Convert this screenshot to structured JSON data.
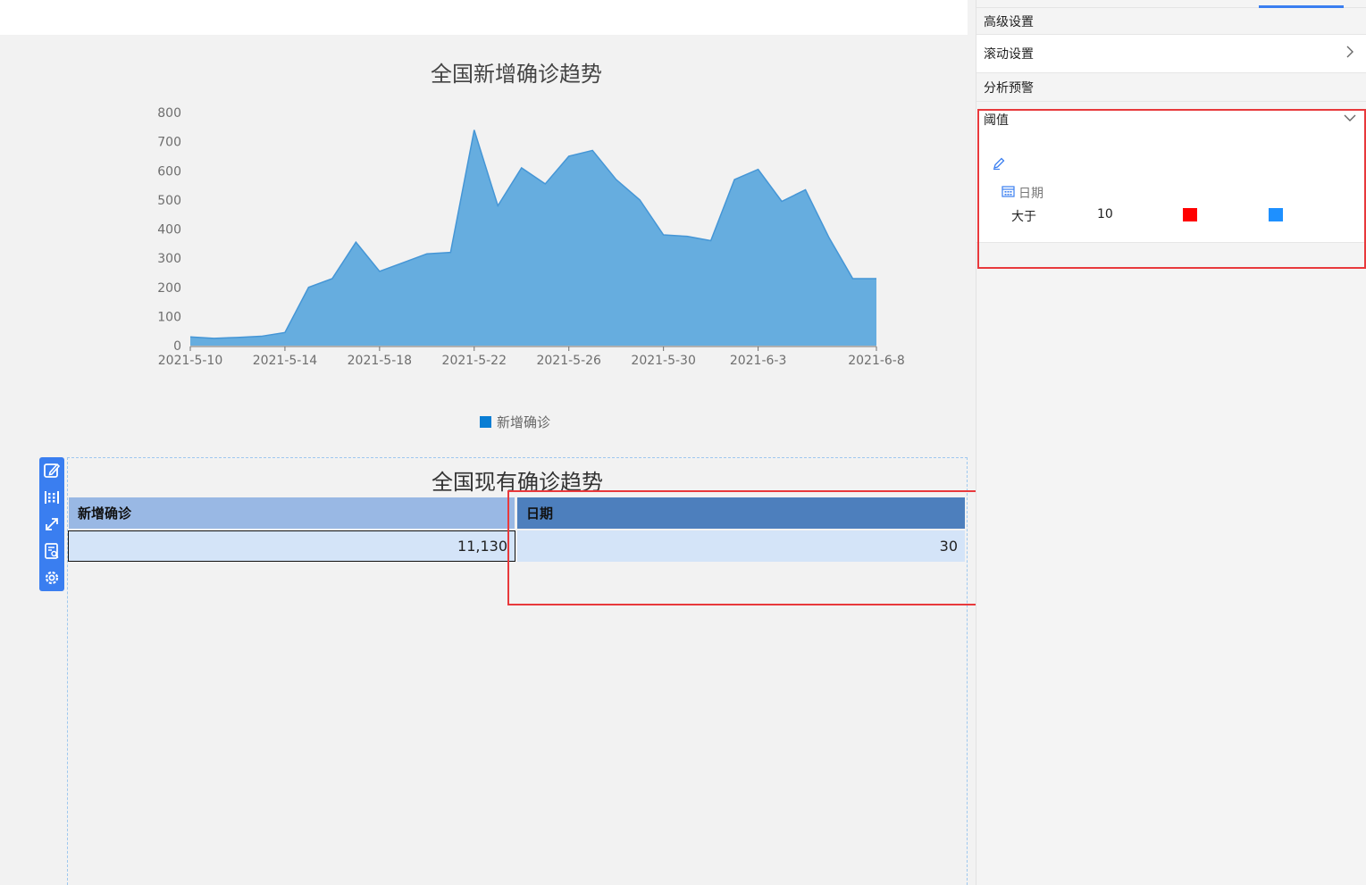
{
  "chart": {
    "title": "全国新增确诊趋势",
    "legend_label": "新增确诊",
    "color": "#66addf",
    "stroke": "#4596d6"
  },
  "chart_data": {
    "type": "area",
    "title": "全国新增确诊趋势",
    "x": [
      "2021-5-10",
      "2021-5-11",
      "2021-5-12",
      "2021-5-13",
      "2021-5-14",
      "2021-5-15",
      "2021-5-16",
      "2021-5-17",
      "2021-5-18",
      "2021-5-19",
      "2021-5-20",
      "2021-5-21",
      "2021-5-22",
      "2021-5-23",
      "2021-5-24",
      "2021-5-25",
      "2021-5-26",
      "2021-5-27",
      "2021-5-28",
      "2021-5-29",
      "2021-5-30",
      "2021-5-31",
      "2021-6-1",
      "2021-6-2",
      "2021-6-3",
      "2021-6-4",
      "2021-6-5",
      "2021-6-6",
      "2021-6-7",
      "2021-6-8"
    ],
    "x_ticks": [
      "2021-5-10",
      "2021-5-14",
      "2021-5-18",
      "2021-5-22",
      "2021-5-26",
      "2021-5-30",
      "2021-6-3",
      "2021-6-8"
    ],
    "series": [
      {
        "name": "新增确诊",
        "values": [
          30,
          25,
          28,
          32,
          45,
          200,
          230,
          355,
          255,
          285,
          315,
          320,
          740,
          480,
          610,
          555,
          650,
          670,
          570,
          500,
          380,
          375,
          360,
          570,
          605,
          495,
          535,
          370,
          230,
          230
        ]
      }
    ],
    "ylim": [
      0,
      800
    ],
    "y_ticks": [
      0,
      100,
      200,
      300,
      400,
      500,
      600,
      700,
      800
    ],
    "grid": false,
    "legend": "bottom"
  },
  "table": {
    "title": "全国现有确诊趋势",
    "columns": [
      "新增确诊",
      "日期"
    ],
    "rows": [
      [
        "11,130",
        "30"
      ]
    ]
  },
  "panel": {
    "advanced_settings": "高级设置",
    "scroll_settings": "滚动设置",
    "analysis_warning": "分析预警",
    "threshold": "阈值",
    "field_name": "日期",
    "condition": "大于",
    "condition_value": "10",
    "color_1": "#ff0000",
    "color_2": "#1e90ff"
  }
}
